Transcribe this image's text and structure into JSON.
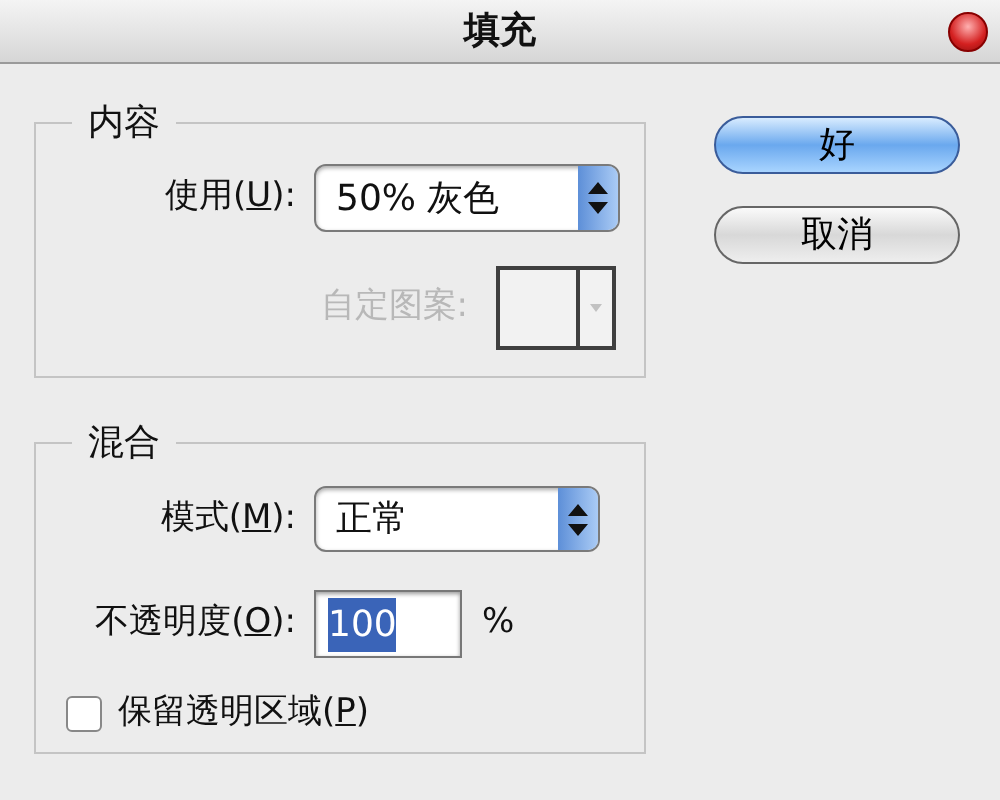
{
  "window": {
    "title": "填充"
  },
  "content_group": {
    "title": "内容",
    "use": {
      "label_before": "使用(",
      "access_key": "U",
      "label_after": "):",
      "value": "50% 灰色"
    },
    "custom_pattern": {
      "label": "自定图案:",
      "disabled": true
    }
  },
  "buttons": [
    {
      "label": "好",
      "default": true
    },
    {
      "label": "取消",
      "default": false
    }
  ],
  "blend_group": {
    "title": "混合",
    "mode": {
      "label_before": "模式(",
      "access_key": "M",
      "label_after": "):",
      "value": "正常"
    },
    "opacity": {
      "label_before": "不透明度(",
      "access_key": "O",
      "label_after": "):",
      "value": "100",
      "highlighted": true,
      "unit": "%"
    },
    "preserve_transparency": {
      "label_before": "保留透明区域(",
      "access_key": "P",
      "label_after": ")",
      "checked": false
    }
  }
}
